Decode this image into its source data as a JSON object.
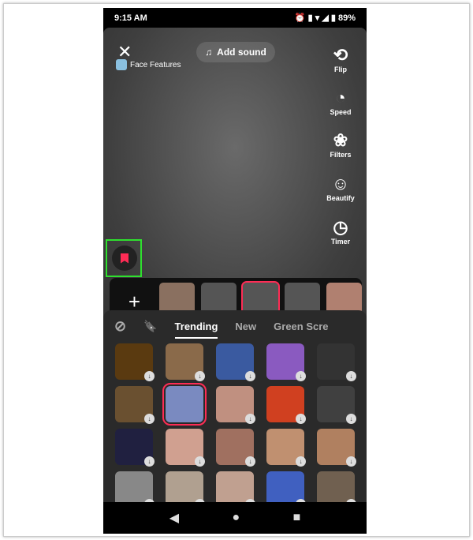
{
  "status": {
    "time": "9:15 AM",
    "battery": "89%",
    "icons": [
      "alarm-icon",
      "vibrate-icon",
      "wifi-icon",
      "signal-icon",
      "battery-icon"
    ]
  },
  "top": {
    "close": "✕",
    "effect_name": "Face Features",
    "add_sound": "Add sound"
  },
  "side": [
    {
      "icon": "⟲",
      "label": "Flip"
    },
    {
      "icon": "◔",
      "label": "Speed"
    },
    {
      "icon": "❀",
      "label": "Filters"
    },
    {
      "icon": "☺",
      "label": "Beautify"
    },
    {
      "icon": "◷",
      "label": "Timer"
    }
  ],
  "strip": {
    "add": "+"
  },
  "tabs": {
    "none": "⊘",
    "saved": "🔖",
    "items": [
      "Trending",
      "New",
      "Green Scre"
    ]
  },
  "grid_colors": [
    "#5a3a10",
    "#8a6a4a",
    "#3a5aa0",
    "#8a5ac0",
    "#333",
    "#6a5030",
    "#7a8ac0",
    "#c09080",
    "#d04020",
    "#404040",
    "#202040",
    "#d0a090",
    "#a07060",
    "#c09070",
    "#b08060",
    "#888",
    "#b0a090",
    "#c0a090",
    "#4060c0",
    "#706050"
  ],
  "accent": "#fe2c55",
  "nav": {
    "back": "◀",
    "home": "●",
    "recents": "■"
  }
}
